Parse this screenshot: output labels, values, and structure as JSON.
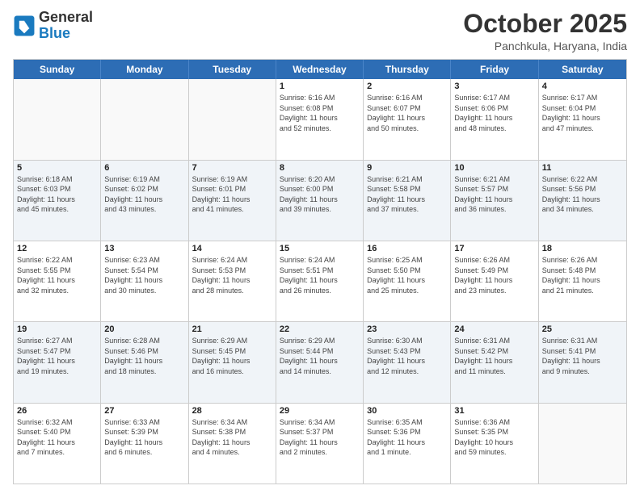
{
  "logo": {
    "line1": "General",
    "line2": "Blue"
  },
  "title": "October 2025",
  "location": "Panchkula, Haryana, India",
  "dayHeaders": [
    "Sunday",
    "Monday",
    "Tuesday",
    "Wednesday",
    "Thursday",
    "Friday",
    "Saturday"
  ],
  "weeks": [
    [
      {
        "day": "",
        "empty": true,
        "info": ""
      },
      {
        "day": "",
        "empty": true,
        "info": ""
      },
      {
        "day": "",
        "empty": true,
        "info": ""
      },
      {
        "day": "1",
        "info": "Sunrise: 6:16 AM\nSunset: 6:08 PM\nDaylight: 11 hours\nand 52 minutes."
      },
      {
        "day": "2",
        "info": "Sunrise: 6:16 AM\nSunset: 6:07 PM\nDaylight: 11 hours\nand 50 minutes."
      },
      {
        "day": "3",
        "info": "Sunrise: 6:17 AM\nSunset: 6:06 PM\nDaylight: 11 hours\nand 48 minutes."
      },
      {
        "day": "4",
        "info": "Sunrise: 6:17 AM\nSunset: 6:04 PM\nDaylight: 11 hours\nand 47 minutes."
      }
    ],
    [
      {
        "day": "5",
        "info": "Sunrise: 6:18 AM\nSunset: 6:03 PM\nDaylight: 11 hours\nand 45 minutes."
      },
      {
        "day": "6",
        "info": "Sunrise: 6:19 AM\nSunset: 6:02 PM\nDaylight: 11 hours\nand 43 minutes."
      },
      {
        "day": "7",
        "info": "Sunrise: 6:19 AM\nSunset: 6:01 PM\nDaylight: 11 hours\nand 41 minutes."
      },
      {
        "day": "8",
        "info": "Sunrise: 6:20 AM\nSunset: 6:00 PM\nDaylight: 11 hours\nand 39 minutes."
      },
      {
        "day": "9",
        "info": "Sunrise: 6:21 AM\nSunset: 5:58 PM\nDaylight: 11 hours\nand 37 minutes."
      },
      {
        "day": "10",
        "info": "Sunrise: 6:21 AM\nSunset: 5:57 PM\nDaylight: 11 hours\nand 36 minutes."
      },
      {
        "day": "11",
        "info": "Sunrise: 6:22 AM\nSunset: 5:56 PM\nDaylight: 11 hours\nand 34 minutes."
      }
    ],
    [
      {
        "day": "12",
        "info": "Sunrise: 6:22 AM\nSunset: 5:55 PM\nDaylight: 11 hours\nand 32 minutes."
      },
      {
        "day": "13",
        "info": "Sunrise: 6:23 AM\nSunset: 5:54 PM\nDaylight: 11 hours\nand 30 minutes."
      },
      {
        "day": "14",
        "info": "Sunrise: 6:24 AM\nSunset: 5:53 PM\nDaylight: 11 hours\nand 28 minutes."
      },
      {
        "day": "15",
        "info": "Sunrise: 6:24 AM\nSunset: 5:51 PM\nDaylight: 11 hours\nand 26 minutes."
      },
      {
        "day": "16",
        "info": "Sunrise: 6:25 AM\nSunset: 5:50 PM\nDaylight: 11 hours\nand 25 minutes."
      },
      {
        "day": "17",
        "info": "Sunrise: 6:26 AM\nSunset: 5:49 PM\nDaylight: 11 hours\nand 23 minutes."
      },
      {
        "day": "18",
        "info": "Sunrise: 6:26 AM\nSunset: 5:48 PM\nDaylight: 11 hours\nand 21 minutes."
      }
    ],
    [
      {
        "day": "19",
        "info": "Sunrise: 6:27 AM\nSunset: 5:47 PM\nDaylight: 11 hours\nand 19 minutes."
      },
      {
        "day": "20",
        "info": "Sunrise: 6:28 AM\nSunset: 5:46 PM\nDaylight: 11 hours\nand 18 minutes."
      },
      {
        "day": "21",
        "info": "Sunrise: 6:29 AM\nSunset: 5:45 PM\nDaylight: 11 hours\nand 16 minutes."
      },
      {
        "day": "22",
        "info": "Sunrise: 6:29 AM\nSunset: 5:44 PM\nDaylight: 11 hours\nand 14 minutes."
      },
      {
        "day": "23",
        "info": "Sunrise: 6:30 AM\nSunset: 5:43 PM\nDaylight: 11 hours\nand 12 minutes."
      },
      {
        "day": "24",
        "info": "Sunrise: 6:31 AM\nSunset: 5:42 PM\nDaylight: 11 hours\nand 11 minutes."
      },
      {
        "day": "25",
        "info": "Sunrise: 6:31 AM\nSunset: 5:41 PM\nDaylight: 11 hours\nand 9 minutes."
      }
    ],
    [
      {
        "day": "26",
        "info": "Sunrise: 6:32 AM\nSunset: 5:40 PM\nDaylight: 11 hours\nand 7 minutes."
      },
      {
        "day": "27",
        "info": "Sunrise: 6:33 AM\nSunset: 5:39 PM\nDaylight: 11 hours\nand 6 minutes."
      },
      {
        "day": "28",
        "info": "Sunrise: 6:34 AM\nSunset: 5:38 PM\nDaylight: 11 hours\nand 4 minutes."
      },
      {
        "day": "29",
        "info": "Sunrise: 6:34 AM\nSunset: 5:37 PM\nDaylight: 11 hours\nand 2 minutes."
      },
      {
        "day": "30",
        "info": "Sunrise: 6:35 AM\nSunset: 5:36 PM\nDaylight: 11 hours\nand 1 minute."
      },
      {
        "day": "31",
        "info": "Sunrise: 6:36 AM\nSunset: 5:35 PM\nDaylight: 10 hours\nand 59 minutes."
      },
      {
        "day": "",
        "empty": true,
        "info": ""
      }
    ]
  ]
}
